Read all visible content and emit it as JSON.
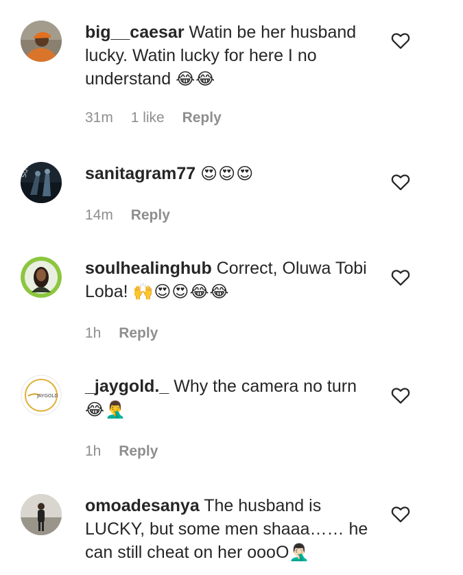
{
  "comments": [
    {
      "username": "big__caesar",
      "text": "Watin be her husband lucky. Watin lucky for here I no understand",
      "emoji": "😂😂",
      "time": "31m",
      "likes": "1 like",
      "reply": "Reply",
      "avatar_icon": "avatar-person-orange-cap"
    },
    {
      "username": "sanitagram77",
      "text": "",
      "emoji": "😍😍😍",
      "time": "14m",
      "likes": "",
      "reply": "Reply",
      "avatar_icon": "avatar-movie-poster"
    },
    {
      "username": "soulhealinghub",
      "text": "Correct, Oluwa Tobi Loba!",
      "emoji": "🙌😍😍😂😂",
      "time": "1h",
      "likes": "",
      "reply": "Reply",
      "avatar_icon": "avatar-woman-green-ring"
    },
    {
      "username": "_jaygold._",
      "text": "Why the camera no turn",
      "emoji": "😂🤦‍♂️",
      "time": "1h",
      "likes": "",
      "reply": "Reply",
      "avatar_icon": "avatar-jaygold-logo"
    },
    {
      "username": "omoadesanya",
      "text": "The husband is LUCKY, but some men shaaa…… he can still cheat on her oooO",
      "emoji": "🤦🏻‍♂️",
      "time": "",
      "likes": "",
      "reply": "",
      "avatar_icon": "avatar-person-standing"
    }
  ],
  "colors": {
    "text": "#262626",
    "meta": "#8e8e8e",
    "heart_stroke": "#262626"
  }
}
